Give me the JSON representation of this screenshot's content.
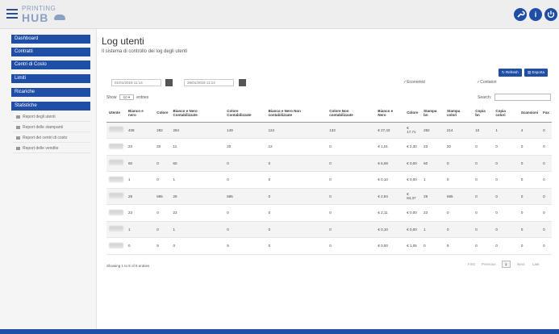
{
  "brand": {
    "line1": "PRINTING",
    "line2": "HUB"
  },
  "topbar": {
    "icons": [
      "wrench-icon",
      "info-icon",
      "power-icon"
    ],
    "info_glyph": "i"
  },
  "sidebar": {
    "items": [
      {
        "label": "Dashboard"
      },
      {
        "label": "Contratti"
      },
      {
        "label": "Centri di Costo"
      },
      {
        "label": "Limiti"
      },
      {
        "label": "Ricariche"
      },
      {
        "label": "Statistiche"
      }
    ],
    "sub_items": [
      {
        "label": "Report degli utenti"
      },
      {
        "label": "Report delle stampanti"
      },
      {
        "label": "Report dei centri di costo"
      },
      {
        "label": "Report delle vendite"
      }
    ]
  },
  "page": {
    "title": "Log utenti",
    "subtitle": "Il sistema di controllo dei log degli utenti"
  },
  "toolbar": {
    "refresh_label": "Refresh",
    "export_label": "Esporta"
  },
  "filters": {
    "date_from": "01/01/2018 11:14",
    "date_to": "26/01/2018 11:14",
    "economici_label": "Economici",
    "contatori_label": "Contatori"
  },
  "table_controls": {
    "show": "Show",
    "entries_value": "10",
    "entries": "entries",
    "search_label": "Search:"
  },
  "table": {
    "columns": [
      "Utente",
      "Bianco e nero",
      "Colore",
      "Bianco e Nero Contabilizzate",
      "Colore Contabilizzate",
      "Bianco e Nero Non contabilizzate",
      "Colore Non contabilizzate",
      "Bianco e Nero",
      "Colore",
      "Stampa bn",
      "Stampa colori",
      "Copia bn",
      "Copia colori",
      "Scansioni",
      "Fax"
    ],
    "rows": [
      [
        "408",
        "282",
        "284",
        "149",
        "124",
        "133",
        "€ 27,43",
        "€ 17,71",
        "282",
        "214",
        "10",
        "1",
        "4",
        "0"
      ],
      [
        "23",
        "20",
        "11",
        "20",
        "12",
        "0",
        "€ 1,01",
        "€ 2,30",
        "23",
        "20",
        "0",
        "0",
        "0",
        "0"
      ],
      [
        "60",
        "0",
        "60",
        "0",
        "0",
        "0",
        "€ 6,08",
        "€ 0,00",
        "60",
        "0",
        "0",
        "0",
        "0",
        "0"
      ],
      [
        "1",
        "0",
        "1",
        "0",
        "0",
        "0",
        "€ 0,10",
        "€ 0,00",
        "1",
        "0",
        "0",
        "0",
        "0",
        "0"
      ],
      [
        "29",
        "695",
        "29",
        "695",
        "0",
        "0",
        "€ 2,94",
        "€ 84,37",
        "29",
        "695",
        "0",
        "0",
        "0",
        "0"
      ],
      [
        "23",
        "0",
        "23",
        "0",
        "0",
        "0",
        "€ 2,11",
        "€ 0,00",
        "23",
        "0",
        "0",
        "0",
        "0",
        "0"
      ],
      [
        "1",
        "0",
        "1",
        "0",
        "0",
        "0",
        "€ 0,10",
        "€ 0,00",
        "1",
        "0",
        "0",
        "0",
        "0",
        "0"
      ],
      [
        "0",
        "9",
        "0",
        "9",
        "0",
        "0",
        "€ 0,00",
        "€ 1,05",
        "0",
        "9",
        "0",
        "0",
        "0",
        "0"
      ]
    ]
  },
  "pagination": {
    "info": "Showing 1 to 8 of 8 entries",
    "first": "First",
    "previous": "Previous",
    "current": "1",
    "next": "Next",
    "last": "Last"
  }
}
